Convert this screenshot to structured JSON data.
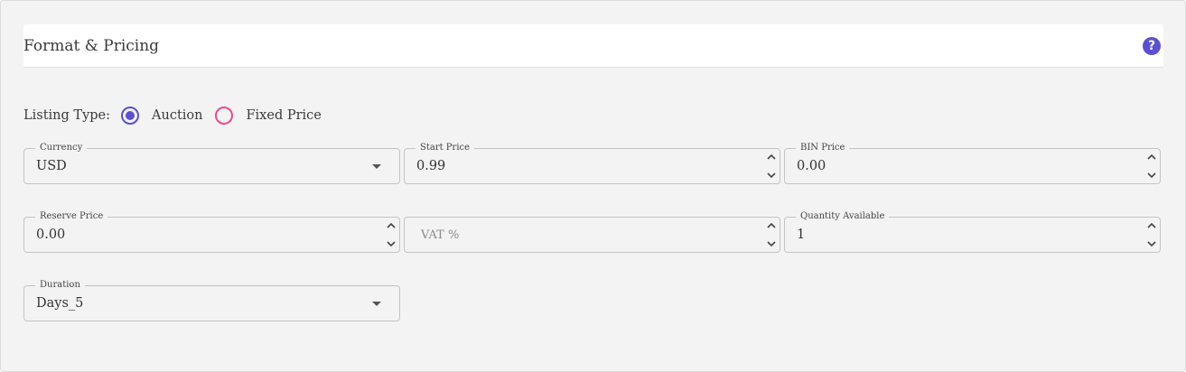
{
  "header": {
    "title": "Format & Pricing",
    "help_icon": "?"
  },
  "listing_type": {
    "label": "Listing Type:",
    "options": [
      {
        "label": "Auction",
        "checked": true,
        "color": "#5b4fd6"
      },
      {
        "label": "Fixed Price",
        "checked": false,
        "color": "#e74c8b"
      }
    ]
  },
  "fields": {
    "currency": {
      "label": "Currency",
      "value": "USD"
    },
    "start_price": {
      "label": "Start Price",
      "value": "0.99"
    },
    "bin_price": {
      "label": "BIN Price",
      "value": "0.00"
    },
    "reserve_price": {
      "label": "Reserve Price",
      "value": "0.00"
    },
    "vat": {
      "placeholder": "VAT %"
    },
    "quantity": {
      "label": "Quantity Available",
      "value": "1"
    },
    "duration": {
      "label": "Duration",
      "value": "Days_5"
    }
  },
  "colors": {
    "accent": "#5b4fd6",
    "secondary": "#e74c8b",
    "panel_bg": "#f3f3f3"
  }
}
